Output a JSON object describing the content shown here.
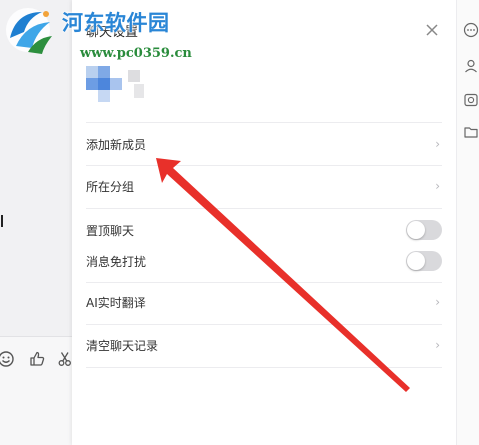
{
  "watermark": {
    "title": "河东软件园",
    "url": "www.pc0359.cn"
  },
  "panel": {
    "title": "聊天设置",
    "items": {
      "add_member": "添加新成员",
      "group": "所在分组",
      "pin_chat": "置顶聊天",
      "mute": "消息免打扰",
      "ai_translate": "AI实时翻译",
      "clear_history": "清空聊天记录"
    },
    "chevron": "›",
    "pin_enabled": false,
    "mute_enabled": false
  },
  "colors": {
    "accent_arrow": "#e8302a",
    "watermark_blue": "#2a86d6",
    "watermark_green": "#2a8c3c",
    "toggle_off": "#d9d9dc"
  },
  "icons": {
    "chat_toolbar": [
      "emoji-icon",
      "thumbs-up-icon",
      "scissors-icon"
    ],
    "right_rail": [
      "more-icon",
      "contact-icon",
      "history-icon",
      "folder-icon"
    ],
    "panel_close": "close-icon"
  }
}
